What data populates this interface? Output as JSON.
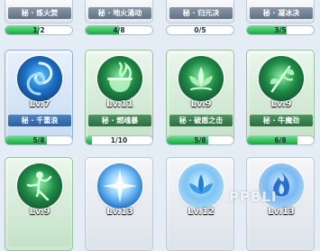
{
  "cards": [
    {
      "name": "秘 · 炼火焚",
      "progress": "1/2",
      "progress_fraction": 0.5,
      "frame": "grey",
      "partial": true
    },
    {
      "name": "秘 · 地火涌动",
      "progress": "4/8",
      "progress_fraction": 0.5,
      "frame": "grey",
      "partial": true
    },
    {
      "name": "秘 · 归元决",
      "progress": "0/5",
      "progress_fraction": 0.0,
      "frame": "grey",
      "partial": true
    },
    {
      "name": "秘 · 凝冰决",
      "progress": "3/5",
      "progress_fraction": 0.6,
      "frame": "grey",
      "partial": true
    },
    {
      "level": "Lv.7",
      "name": "秘 · 千重浪",
      "progress": "5/8",
      "progress_fraction": 0.625,
      "frame": "blue",
      "medal": "blue",
      "icon": "water-swirl-icon"
    },
    {
      "level": "Lv.11",
      "name": "秘 · 燃魂暴",
      "progress": "1/10",
      "progress_fraction": 0.1,
      "frame": "green",
      "medal": "green",
      "icon": "cauldron-flame-icon"
    },
    {
      "level": "Lv.9",
      "name": "秘 · 破盾之击",
      "progress": "5/8",
      "progress_fraction": 0.625,
      "frame": "green",
      "medal": "green",
      "icon": "lotus-icon"
    },
    {
      "level": "Lv.9",
      "name": "秘 · 牛魔劲",
      "progress": "6/8",
      "progress_fraction": 0.75,
      "frame": "green",
      "medal": "green",
      "icon": "leaf-staff-icon"
    },
    {
      "level": "Lv.9",
      "frame": "green",
      "medal": "green",
      "icon": "dancer-icon"
    },
    {
      "level": "Lv.13",
      "frame": "grey",
      "medal": "light-blue",
      "icon": "ice-burst-icon"
    },
    {
      "level": "Lv.12",
      "frame": "grey",
      "medal": "light-blue",
      "icon": "lotus-blue-icon"
    },
    {
      "level": "Lv.13",
      "frame": "grey",
      "medal": "light-blue",
      "icon": "blue-flame-icon"
    }
  ],
  "watermark": "PPBLI",
  "colors": {
    "progress_fill": "#2dbb55",
    "background": "#e4edf6"
  }
}
